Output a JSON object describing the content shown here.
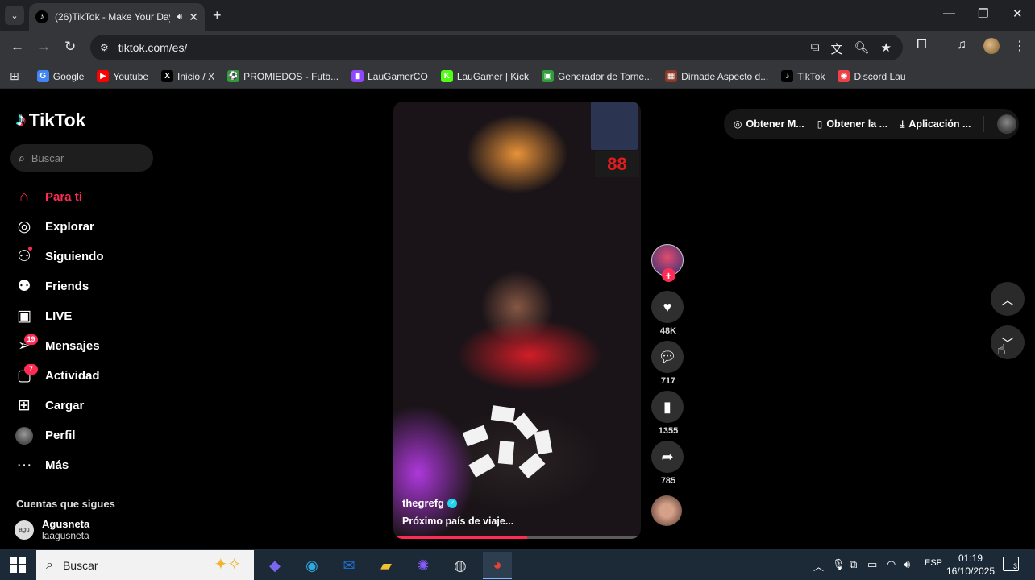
{
  "browser": {
    "tab_title": "(26)TikTok - Make Your Day",
    "url": "tiktok.com/es/",
    "bookmarks": [
      {
        "label": "Google",
        "icon": "google-icon",
        "color": "#4285f4"
      },
      {
        "label": "Youtube",
        "icon": "youtube-icon",
        "color": "#ff0000"
      },
      {
        "label": "Inicio / X",
        "icon": "x-icon",
        "color": "#000000"
      },
      {
        "label": "PROMIEDOS - Futb...",
        "icon": "promiedos-icon",
        "color": "#2e9e3a"
      },
      {
        "label": "LauGamerCO",
        "icon": "twitch-icon",
        "color": "#9146ff"
      },
      {
        "label": "LauGamer | Kick",
        "icon": "kick-icon",
        "color": "#53fc18"
      },
      {
        "label": "Generador de Torne...",
        "icon": "generator-icon",
        "color": "#2e9e3a"
      },
      {
        "label": "Dirnade Aspecto d...",
        "icon": "image-icon",
        "color": "#8a3a2a"
      },
      {
        "label": "TikTok",
        "icon": "tiktok-icon",
        "color": "#000000"
      },
      {
        "label": "Discord Lau",
        "icon": "discord-icon",
        "color": "#ed4245"
      }
    ]
  },
  "tiktok": {
    "logo": "TikTok",
    "search_placeholder": "Buscar",
    "nav": [
      {
        "label": "Para ti",
        "icon": "home-icon",
        "active": true
      },
      {
        "label": "Explorar",
        "icon": "compass-icon"
      },
      {
        "label": "Siguiendo",
        "icon": "following-icon",
        "dot": true
      },
      {
        "label": "Friends",
        "icon": "friends-icon"
      },
      {
        "label": "LIVE",
        "icon": "live-icon"
      },
      {
        "label": "Mensajes",
        "icon": "messages-icon",
        "badge": "19"
      },
      {
        "label": "Actividad",
        "icon": "activity-icon",
        "badge": "7"
      },
      {
        "label": "Cargar",
        "icon": "upload-icon"
      },
      {
        "label": "Perfil",
        "icon": "profile-avatar"
      },
      {
        "label": "Más",
        "icon": "more-icon"
      }
    ],
    "following_title": "Cuentas que sigues",
    "followed_account": {
      "name": "Agusneta",
      "handle": "laagusneta"
    },
    "topbar": {
      "item1": "Obtener M...",
      "item2": "Obtener la ...",
      "item3": "Aplicación ..."
    },
    "video": {
      "username": "thegrefg",
      "description": "Próximo país de viaje...",
      "clock_text": "88",
      "progress": 0.54
    },
    "actions": {
      "likes": "48K",
      "comments": "717",
      "saves": "1355",
      "shares": "785"
    }
  },
  "taskbar": {
    "search_text": "Buscar",
    "lang": "ESP",
    "time": "01:19",
    "date": "16/10/2025",
    "notifications": "3"
  }
}
